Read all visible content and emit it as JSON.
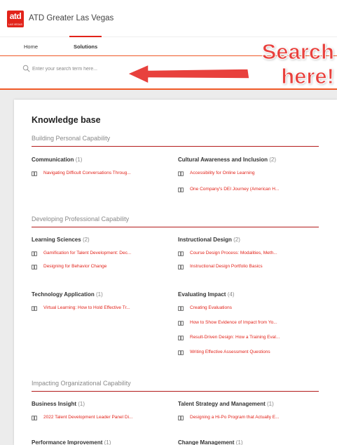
{
  "header": {
    "logo_text": "atd",
    "logo_sub": "LAS VEGAS",
    "org_name": "ATD Greater Las Vegas"
  },
  "nav": {
    "tabs": [
      {
        "label": "Home"
      },
      {
        "label": "Solutions"
      }
    ]
  },
  "search": {
    "placeholder": "Enter your search term here..."
  },
  "callout": {
    "line1": "Search",
    "line2": "here!"
  },
  "knowledge_base": {
    "title": "Knowledge base",
    "sections": [
      {
        "title": "Building Personal Capability",
        "categories": [
          {
            "name": "Communication",
            "count": "(1)",
            "articles": [
              "Navigating Difficult Conversations Throug..."
            ]
          },
          {
            "name": "Cultural Awareness and Inclusion",
            "count": "(2)",
            "articles": [
              "Accessibility for Online Learning",
              "One Company's DEI Journey (American H..."
            ]
          }
        ]
      },
      {
        "title": "Developing Professional Capability",
        "categories": [
          {
            "name": "Learning Sciences",
            "count": "(2)",
            "articles": [
              "Gamification for Talent Development: Dec...",
              "Designing for Behavior Change"
            ]
          },
          {
            "name": "Instructional Design",
            "count": "(2)",
            "articles": [
              "Course Design Process: Modalities, Meth...",
              "Instructional Design Portfolio Basics"
            ]
          },
          {
            "name": "Technology Application",
            "count": "(1)",
            "articles": [
              "Virtual Learning: How to Hold Effective Tr..."
            ]
          },
          {
            "name": "Evaluating Impact",
            "count": "(4)",
            "articles": [
              "Creating Evaluations",
              "How to Show Evidence of Impact from Yo...",
              "Result-Driven Design: How a Training Eval...",
              "Writing Effective Assessment Questions"
            ]
          }
        ]
      },
      {
        "title": "Impacting Organizational Capability",
        "categories": [
          {
            "name": "Business Insight",
            "count": "(1)",
            "articles": [
              "2022 Talent Development Leader Panel Di..."
            ]
          },
          {
            "name": "Talent Strategy and Management",
            "count": "(1)",
            "articles": [
              "Designing a Hi-Po Program that Actually E..."
            ]
          },
          {
            "name": "Performance Improvement",
            "count": "(1)",
            "articles": []
          },
          {
            "name": "Change Management",
            "count": "(1)",
            "articles": []
          }
        ]
      }
    ]
  },
  "colors": {
    "accent": "#e2231a",
    "orange_rule": "#f05a28",
    "callout": "#e8413d"
  }
}
